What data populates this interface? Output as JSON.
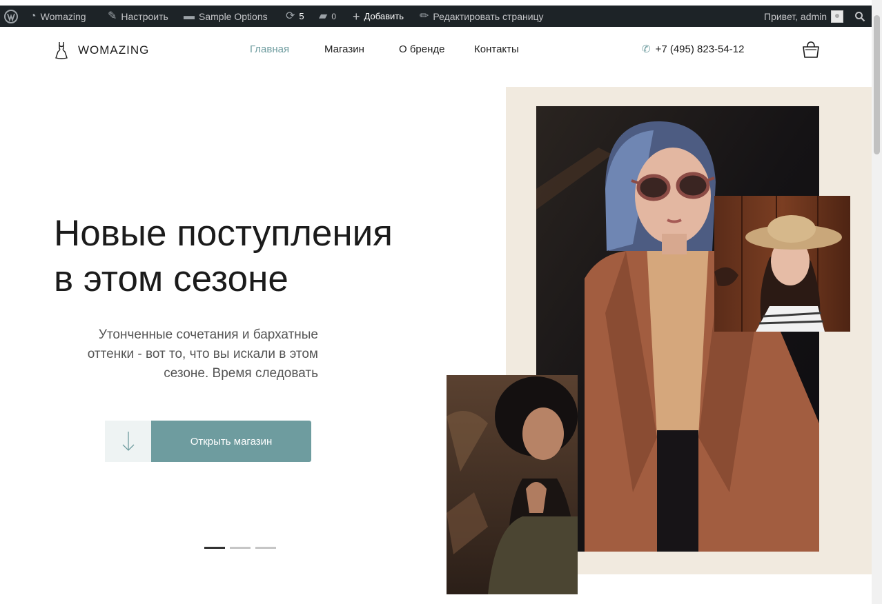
{
  "admin_bar": {
    "wp_logo_icon": "wordpress-icon",
    "site_name": "Womazing",
    "customize": "Настроить",
    "sample_options": "Sample Options",
    "updates_count": "5",
    "comments_count": "0",
    "add_new": "Добавить",
    "edit_page": "Редактировать страницу",
    "greeting": "Привет, admin"
  },
  "header": {
    "logo_text": "WOMAZING",
    "logo_icon": "dress-icon",
    "nav": [
      {
        "label": "Главная",
        "active": true
      },
      {
        "label": "Магазин",
        "active": false
      },
      {
        "label": "О бренде",
        "active": false
      },
      {
        "label": "Контакты",
        "active": false
      }
    ],
    "phone": "+7 (495) 823-54-12",
    "phone_icon": "phone-icon",
    "cart_icon": "basket-icon"
  },
  "hero": {
    "title_line1": "Новые поступления",
    "title_line2": "в этом сезоне",
    "subtitle_line1": "Утонченные сочетания и бархатные",
    "subtitle_line2": "оттенки - вот то, что вы искали в этом",
    "subtitle_line3": "сезоне. Время следовать",
    "scroll_icon": "arrow-down-icon",
    "cta_label": "Открыть магазин",
    "slides_total": 3,
    "active_slide": 1
  },
  "colors": {
    "accent": "#6e9c9f",
    "admin_bar_bg": "#1d2327",
    "beige_panel": "#f1eadf",
    "text": "#1b1b1b"
  }
}
